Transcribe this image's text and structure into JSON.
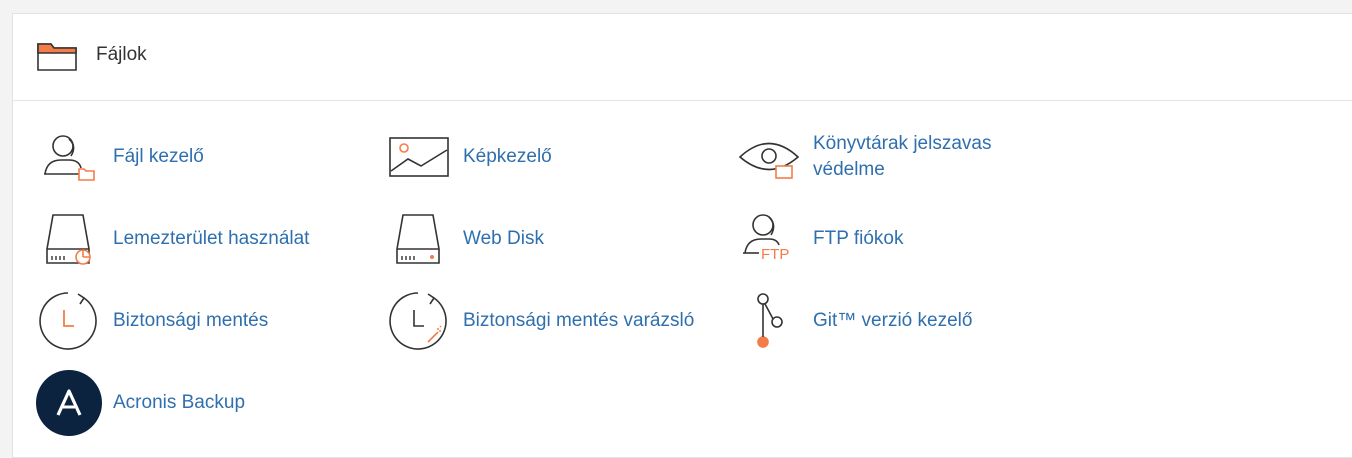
{
  "section": {
    "title": "Fájlok",
    "icon": "folder-icon"
  },
  "items": [
    {
      "label": "Fájl kezelő",
      "icon": "file-manager-icon"
    },
    {
      "label": "Képkezelő",
      "icon": "image-icon"
    },
    {
      "label": "Könyvtárak jelszavas védelme",
      "icon": "eye-lock-icon"
    },
    {
      "label": "Lemezterület használat",
      "icon": "disk-usage-icon"
    },
    {
      "label": "Web Disk",
      "icon": "drive-icon"
    },
    {
      "label": "FTP fiókok",
      "icon": "ftp-user-icon",
      "icon_text": "FTP"
    },
    {
      "label": "Biztonsági mentés",
      "icon": "backup-clock-icon"
    },
    {
      "label": "Biztonsági mentés varázsló",
      "icon": "backup-wizard-icon"
    },
    {
      "label": "Git™ verzió kezelő",
      "icon": "git-branch-icon"
    },
    {
      "label": "Acronis Backup",
      "icon": "acronis-logo-icon",
      "icon_text": "A"
    }
  ],
  "colors": {
    "link": "#2f6fae",
    "accent": "#f47c48",
    "icon_stroke": "#333333",
    "acronis_bg": "#0c2340"
  }
}
